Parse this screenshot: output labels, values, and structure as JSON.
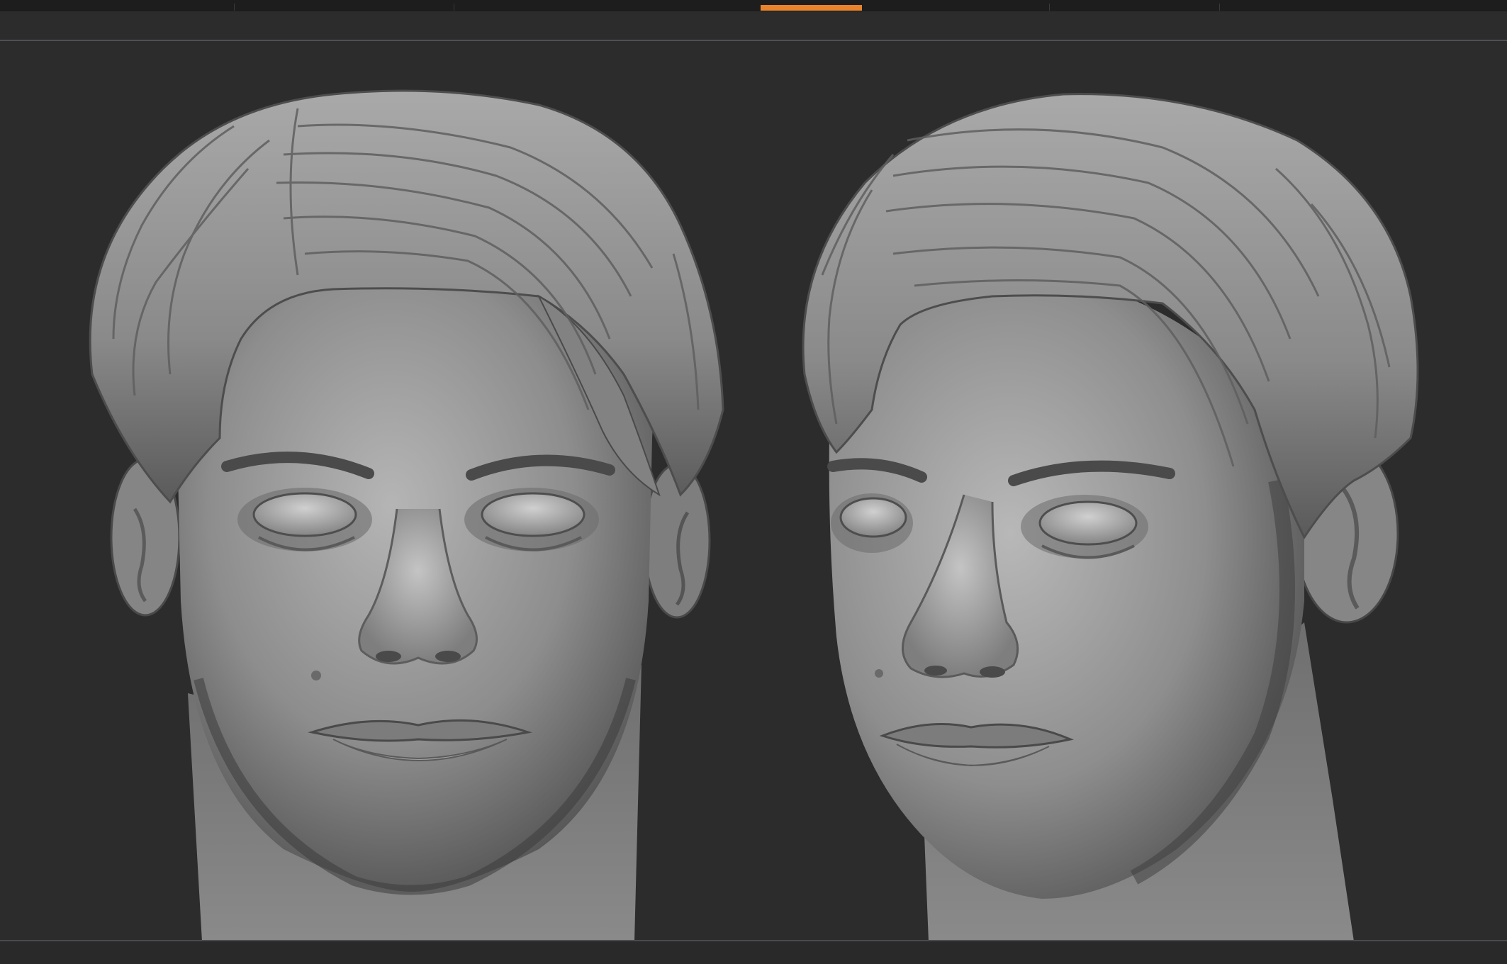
{
  "viewport": {
    "render_mode": "matcap-gray-sculpt",
    "views": [
      "front",
      "three-quarter"
    ]
  },
  "timeline": {
    "progress": 0.068
  },
  "colors": {
    "background": "#2c2c2d",
    "toolbar": "#1d1d1e",
    "accent": "#e8832b",
    "clay_light": "#bdbdbd",
    "clay_mid": "#8a8a8a",
    "clay_dark": "#3a3a3a"
  }
}
